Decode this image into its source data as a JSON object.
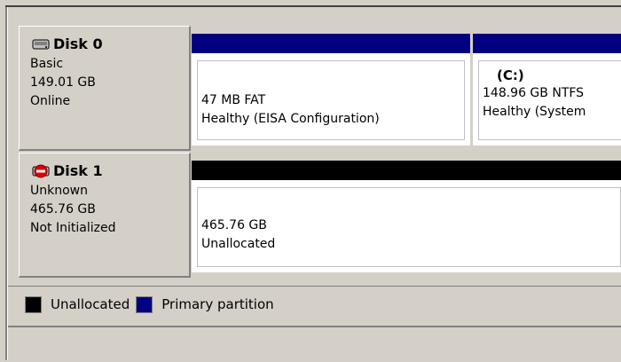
{
  "disks": [
    {
      "name": "Disk 0",
      "type": "Basic",
      "size": "149.01 GB",
      "status": "Online",
      "icon": "disk-icon",
      "volumes": [
        {
          "title": "",
          "line1": "47 MB FAT",
          "line2": "Healthy (EISA Configuration)",
          "bar_color": "#000080"
        },
        {
          "title": "(C:)",
          "line1": "148.96 GB NTFS",
          "line2": "Healthy (System",
          "bar_color": "#000080"
        }
      ]
    },
    {
      "name": "Disk 1",
      "type": "Unknown",
      "size": "465.76 GB",
      "status": "Not Initialized",
      "icon": "disk-error-icon",
      "volumes": [
        {
          "title": "",
          "line1": "465.76 GB",
          "line2": "Unallocated",
          "bar_color": "#000000"
        }
      ]
    }
  ],
  "legend": [
    {
      "label": "Unallocated",
      "color": "#000000"
    },
    {
      "label": "Primary partition",
      "color": "#000080"
    }
  ]
}
